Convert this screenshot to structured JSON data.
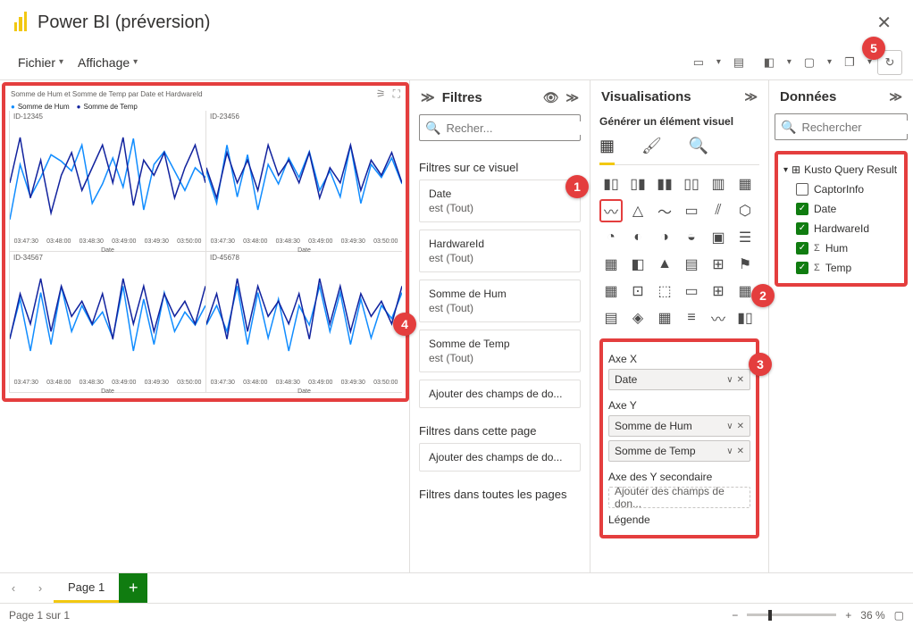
{
  "app": {
    "title": "Power BI (préversion)"
  },
  "menu": {
    "file": "Fichier",
    "view": "Affichage"
  },
  "visual": {
    "title": "Somme de Hum et Somme de Temp par Date et HardwareId",
    "legend": [
      "Somme de Hum",
      "Somme de Temp"
    ],
    "small_multiples": [
      "ID-12345",
      "ID-23456",
      "ID-34567",
      "ID-45678"
    ],
    "xlabel": "Date",
    "xticks": [
      "03:47:30",
      "03:48:00",
      "03:48:30",
      "03:49:00",
      "03:49:30",
      "03:50:00"
    ]
  },
  "filters": {
    "header": "Filtres",
    "search_placeholder": "Recher...",
    "on_visual": "Filtres sur ce visuel",
    "items": [
      {
        "title": "Date",
        "state": "est (Tout)"
      },
      {
        "title": "HardwareId",
        "state": "est (Tout)"
      },
      {
        "title": "Somme de Hum",
        "state": "est (Tout)"
      },
      {
        "title": "Somme de Temp",
        "state": "est (Tout)"
      }
    ],
    "add": "Ajouter des champs de do...",
    "on_page": "Filtres dans cette page",
    "on_all": "Filtres dans toutes les pages"
  },
  "viz": {
    "header": "Visualisations",
    "subtitle": "Générer un élément visuel",
    "wells": {
      "x": {
        "label": "Axe X",
        "chips": [
          "Date"
        ]
      },
      "y": {
        "label": "Axe Y",
        "chips": [
          "Somme de Hum",
          "Somme de Temp"
        ]
      },
      "y2": {
        "label": "Axe des Y secondaire",
        "placeholder": "Ajouter des champs de don..."
      },
      "legend": {
        "label": "Légende"
      }
    }
  },
  "data": {
    "header": "Données",
    "search_placeholder": "Rechercher",
    "group": "Kusto Query Result",
    "fields": [
      {
        "name": "CaptorInfo",
        "checked": false,
        "sigma": false
      },
      {
        "name": "Date",
        "checked": true,
        "sigma": false
      },
      {
        "name": "HardwareId",
        "checked": true,
        "sigma": false
      },
      {
        "name": "Hum",
        "checked": true,
        "sigma": true
      },
      {
        "name": "Temp",
        "checked": true,
        "sigma": true
      }
    ]
  },
  "pages": {
    "page1": "Page 1"
  },
  "status": {
    "pageinfo": "Page 1 sur 1",
    "zoom": "36 %"
  },
  "callouts": {
    "1": "1",
    "2": "2",
    "3": "3",
    "4": "4",
    "5": "5"
  },
  "chart_data": {
    "type": "line",
    "title": "Somme de Hum et Somme de Temp par Date et HardwareId",
    "xlabel": "Date",
    "series_names": [
      "Somme de Hum",
      "Somme de Temp"
    ],
    "facets": [
      {
        "id": "ID-12345",
        "hum": [
          55,
          72,
          62,
          68,
          75,
          73,
          70,
          78,
          60,
          66,
          74,
          65,
          80,
          58,
          72,
          76,
          70,
          64,
          71,
          68
        ],
        "temp": [
          22,
          28,
          20,
          25,
          18,
          23,
          26,
          21,
          24,
          27,
          22,
          28,
          19,
          25,
          23,
          26,
          20,
          24,
          27,
          22
        ]
      },
      {
        "id": "ID-23456",
        "hum": [
          70,
          60,
          78,
          62,
          75,
          58,
          72,
          66,
          74,
          68,
          76,
          64,
          70,
          62,
          78,
          60,
          72,
          68,
          74,
          66
        ],
        "temp": [
          24,
          20,
          26,
          22,
          25,
          21,
          27,
          23,
          25,
          22,
          26,
          20,
          24,
          22,
          27,
          21,
          25,
          23,
          26,
          22
        ]
      },
      {
        "id": "ID-34567",
        "hum": [
          62,
          74,
          58,
          76,
          60,
          78,
          64,
          72,
          66,
          70,
          62,
          78,
          58,
          74,
          60,
          76,
          64,
          70,
          66,
          72
        ],
        "temp": [
          20,
          26,
          22,
          28,
          21,
          27,
          23,
          25,
          22,
          26,
          20,
          28,
          22,
          27,
          21,
          26,
          23,
          25,
          22,
          27
        ]
      },
      {
        "id": "ID-45678",
        "hum": [
          66,
          72,
          64,
          78,
          60,
          76,
          62,
          74,
          58,
          72,
          66,
          78,
          64,
          76,
          60,
          74,
          62,
          72,
          68,
          76
        ],
        "temp": [
          22,
          26,
          20,
          28,
          21,
          27,
          23,
          25,
          22,
          26,
          20,
          28,
          22,
          27,
          21,
          26,
          23,
          25,
          22,
          27
        ]
      }
    ]
  }
}
